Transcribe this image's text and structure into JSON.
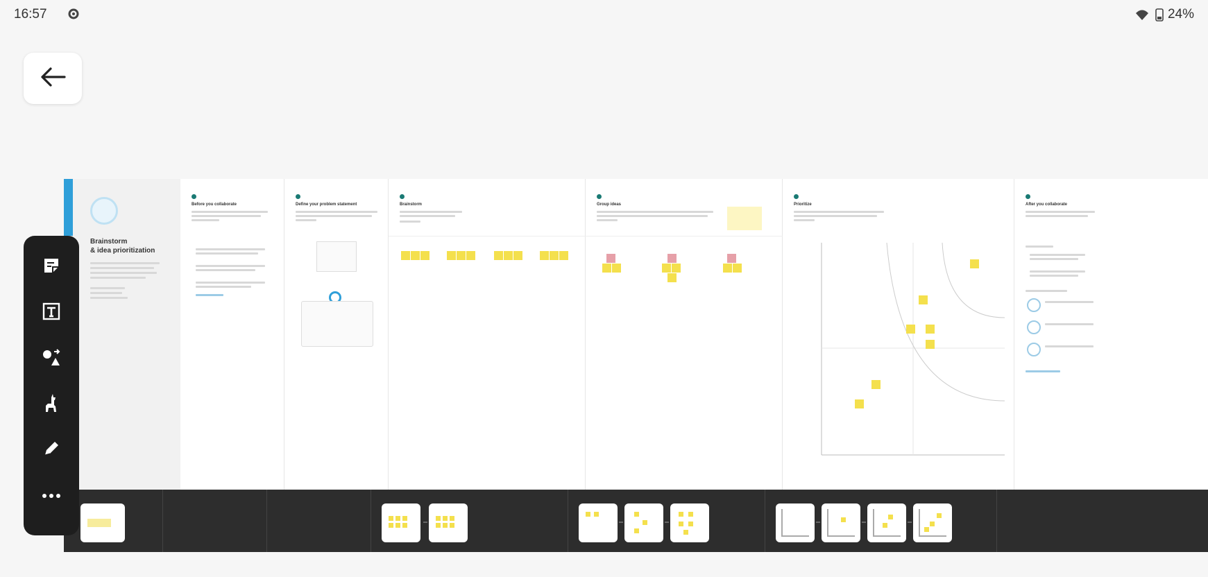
{
  "status_bar": {
    "time": "16:57",
    "battery": "24%",
    "icons": [
      "gear-icon",
      "wifi-icon",
      "battery-icon"
    ]
  },
  "back_button": {
    "icon": "arrow-left-icon"
  },
  "toolbar": {
    "tools": [
      "sticky-note-icon",
      "text-icon",
      "shapes-icon",
      "llama-icon",
      "pencil-icon",
      "more-icon"
    ]
  },
  "board": {
    "cover": {
      "title_line1": "Brainstorm",
      "title_line2": "& idea prioritization"
    },
    "frames": [
      {
        "title": "Before you collaborate"
      },
      {
        "title": "Define your problem statement"
      },
      {
        "title": "Brainstorm"
      },
      {
        "title": "Group ideas"
      },
      {
        "title": "Prioritize"
      },
      {
        "title": "After you collaborate"
      }
    ]
  },
  "colors": {
    "accent_teal": "#1a7a74",
    "sticky_yellow": "#f4e04d",
    "sticky_pink": "#e6a0a8",
    "cover_tab_blue": "#2f9fd9",
    "toolbar_bg": "#1e1e1e",
    "strip_bg": "#2d2d2d"
  }
}
